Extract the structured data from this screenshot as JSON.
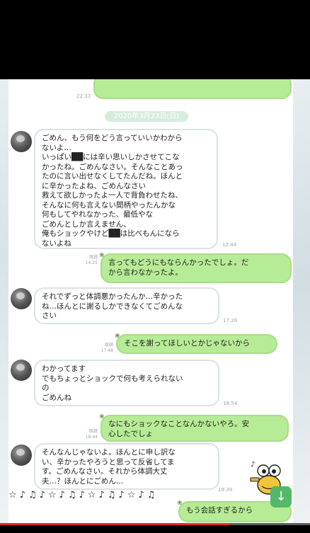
{
  "chat": {
    "top_time": "22:33",
    "date": "2020年3月23日(日)",
    "messages": [
      {
        "side": "left",
        "text": "ごめん、もう何をどう言っていいかわから\nないよ…\nいっぱい██には辛い思いしかさせてこな\nかったね。ごめんなさい。そんなことあっ\nたのに言い出せなくしてたんだね。ほんと\nに辛かったよね、ごめんなさい\n救えて欲しかったよ一人で背負わせたね、\nそんなに何も言えない間柄やったんかな\n何もしてやれなかった、最低やな\nごめんとしか言えません、\n俺もショックやけど██は比べもんになら\nないよね",
        "time": "12:44"
      },
      {
        "side": "right",
        "text": "言ってもどうにもならんかったでしょ。だ\nから言わなかったよ。",
        "read": "既読",
        "time": "14:25"
      },
      {
        "side": "left",
        "text": "それでずっと体調悪かったんか…辛かった\nね…ほんとに謝るしかできなくてごめんな\nさい",
        "time": "17:26"
      },
      {
        "side": "right",
        "text": "そこを謝ってほしいとかじゃないから",
        "read": "既読",
        "time": "17:48"
      },
      {
        "side": "left",
        "text": "わかってます\nでもちょっとショックで何も考えられない\nの\nごめんね",
        "time": "18:54"
      },
      {
        "side": "right",
        "text": "なにもショックなことなんかないやろ。安\n心したでしょ",
        "read": "既読",
        "time": "18:44"
      },
      {
        "side": "left",
        "text": "そんなんじゃないよ。ほんとに申し訳な\nい、辛かったやろうと思って反省してま\nす。ごめんなさい。それから体調大丈\n夫…？ほんとにごめん…",
        "time": "19:39"
      }
    ],
    "last_partial": "もう会話すぎるから",
    "notes": "☆♪♫♪☆♪♫♪☆♪♫♪☆♪♫"
  },
  "progress": {
    "played_fraction": 0.74
  },
  "colors": {
    "bubble_out": "#b7ec96",
    "accent": "#54b86a",
    "progress": "#e5291d"
  }
}
